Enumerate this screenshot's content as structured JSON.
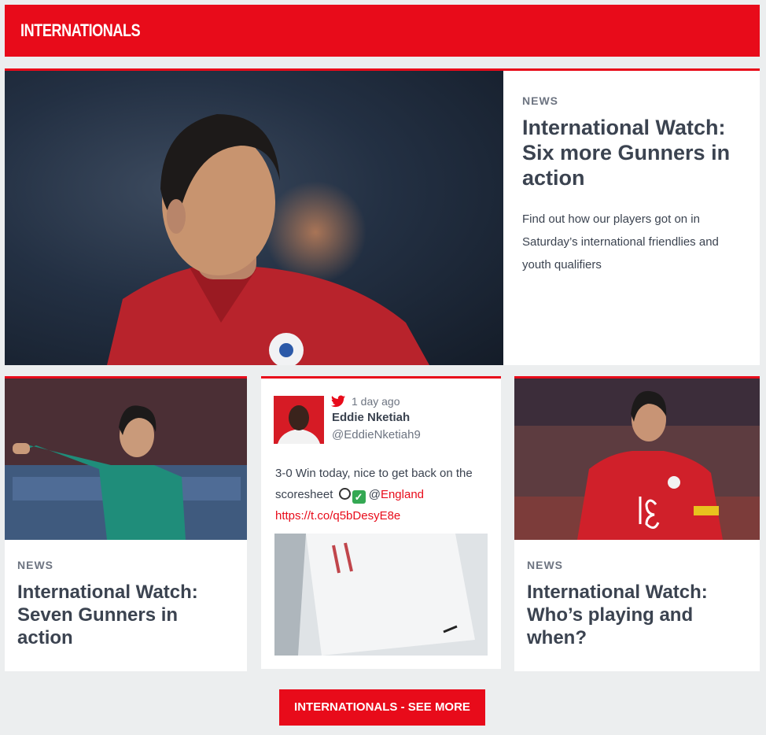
{
  "header": {
    "title": "INTERNATIONALS"
  },
  "hero": {
    "kicker": "NEWS",
    "title": "International Watch: Six more Gunners in action",
    "description": "Find out how our players got on in Saturday’s international friendlies and youth qualifiers"
  },
  "cards": [
    {
      "kicker": "NEWS",
      "title": "International Watch: Seven Gunners in action"
    },
    {
      "kicker": "NEWS",
      "title": "International Watch: Who’s playing and when?"
    }
  ],
  "tweet": {
    "time": "1 day ago",
    "name": "Eddie Nketiah",
    "handle": "@EddieNketiah9",
    "text_before": "3-0 Win today, nice to get back on the scoresheet ",
    "mention_prefix": "@",
    "mention": "England",
    "link": "https://t.co/q5bDesyE8e"
  },
  "see_more": {
    "label": "INTERNATIONALS - SEE MORE"
  },
  "icons": {
    "twitter": "twitter-bird-icon",
    "ball": "soccer-ball-icon",
    "check": "check-mark-icon"
  },
  "colors": {
    "accent": "#e80b1a",
    "text": "#3b4350",
    "muted": "#6d7481"
  }
}
